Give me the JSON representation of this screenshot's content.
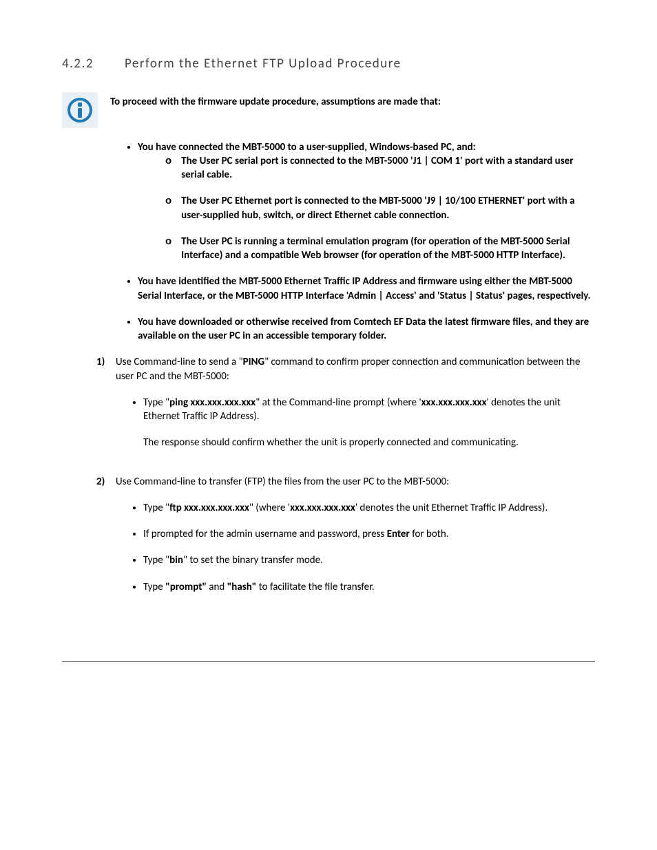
{
  "heading_num": "4.2.2",
  "heading_title": "Perform the Ethernet FTP Upload Procedure",
  "intro": "To proceed with the firmware update procedure, assumptions are made that:",
  "a1_prefix": "You have connected the MBT-5000 to a user-supplied, Windows-based PC, and:",
  "a1_s1_a": "The User PC serial port is connected to the MBT-5000 ",
  "a1_s1_b": "'J1 | COM 1'",
  "a1_s1_c": " port with a standard user serial cable.",
  "a1_s2": "The User PC Ethernet port is connected to the MBT-5000 'J9 | 10/100 ETHERNET'  port with a user-supplied hub, switch, or direct Ethernet cable connection.",
  "a1_s3": "The User PC is running a terminal emulation program (for operation of the MBT-5000 Serial Interface) and a compatible Web browser (for operation of the MBT-5000 HTTP Interface).",
  "a2": "You have identified the MBT-5000 Ethernet Traffic IP Address and firmware using either the MBT-5000 Serial Interface, or the MBT-5000 HTTP Interface 'Admin | Access' and 'Status | Status'  pages, respectively.",
  "a3": "You have downloaded or otherwise received from Comtech EF Data the latest firmware files, and they are available on the user PC in an accessible temporary folder.",
  "step1_num": "1)",
  "step1_a": "Use Command-line to send a \"",
  "step1_b": "PING",
  "step1_c": "\" command to confirm proper connection and communication between the user PC and the MBT-5000:",
  "s1b1_a": "Type \"",
  "s1b1_b": "ping xxx.xxx.xxx.xxx",
  "s1b1_c": "\" at the Command-line prompt (where '",
  "s1b1_d": "xxx.xxx.xxx.xxx",
  "s1b1_e": "' denotes the unit Ethernet Traffic IP Address).",
  "s1b1_f": "The response should confirm whether the unit is properly connected and communicating.",
  "step2_num": "2)",
  "step2_a": "Use Command-line to transfer (FTP) the files from the user PC to the MBT-5000:",
  "s2b1_a": "Type \"",
  "s2b1_b": "ftp xxx.xxx.xxx.xxx",
  "s2b1_c": "\" (where '",
  "s2b1_d": "xxx.xxx.xxx.xxx",
  "s2b1_e": "' denotes the unit Ethernet Traffic IP Address).",
  "s2b2_a": "If prompted for the admin username and password, press ",
  "s2b2_b": "Enter",
  "s2b2_c": " for both.",
  "s2b3_a": "Type \"",
  "s2b3_b": "bin",
  "s2b3_c": "\" to set the binary transfer mode.",
  "s2b4_a": "Type ",
  "s2b4_b": "\"prompt\"",
  "s2b4_c": " and ",
  "s2b4_d": "\"hash\"",
  "s2b4_e": " to facilitate the file transfer."
}
